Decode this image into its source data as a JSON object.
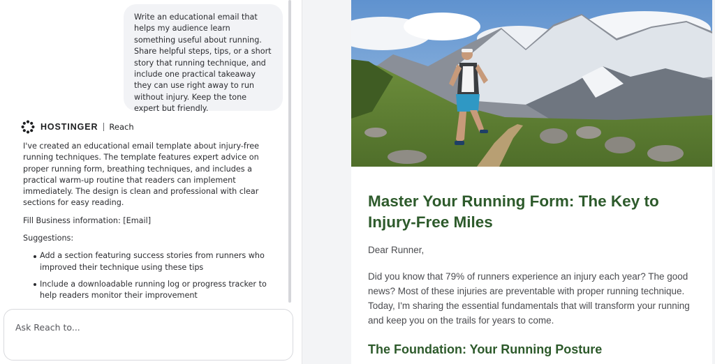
{
  "chat": {
    "user_prompt": "Write an educational email that helps my audience learn something useful about running. Share helpful steps, tips, or a short story that running technique, and include one practical takeaway they can use right away to run without injury. Keep the tone expert but friendly.",
    "brand": {
      "name": "HOSTINGER",
      "product": "Reach",
      "logo_icon": "hostinger-logo-icon"
    },
    "assistant_reply": {
      "intro": "I've created an educational email template about injury-free running techniques. The template features expert advice on proper running form, breathing techniques, and includes a practical warm-up routine that readers can implement immediately. The design is clean and professional with clear sections for easy reading.",
      "business_info": "Fill Business information: [Email]",
      "suggestions_label": "Suggestions:",
      "suggestions": [
        "Add a section featuring success stories from runners who improved their technique using these tips",
        "Include a downloadable running log or progress tracker to help readers monitor their improvement"
      ]
    },
    "composer": {
      "placeholder": "Ask Reach to..."
    }
  },
  "email": {
    "hero_image": "trail-runner-mountains-image",
    "title": "Master Your Running Form: The Key to Injury-Free Miles",
    "greeting": "Dear Runner,",
    "intro_paragraph": "Did you know that 79% of runners experience an injury each year? The good news? Most of these injuries are preventable with proper running technique. Today, I'm sharing the essential fundamentals that will transform your running and keep you on the trails for years to come.",
    "section_heading": "The Foundation: Your Running Posture"
  },
  "colors": {
    "heading_green": "#2d5a2b",
    "preview_background": "#f3f4f6",
    "user_bubble": "#f2f3f6"
  }
}
